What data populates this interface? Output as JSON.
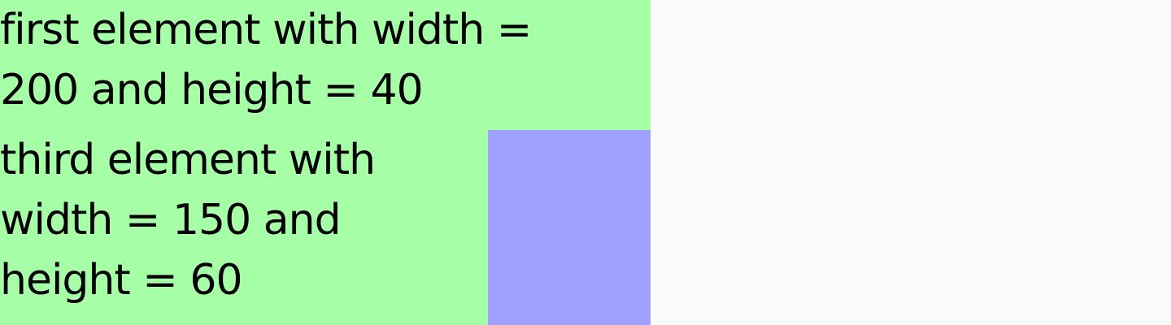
{
  "elements": {
    "first": {
      "line1": "first element with width =",
      "line2": "200 and height = 40"
    },
    "third": {
      "line1": "third element with",
      "line2": "width = 150 and",
      "line3": "height = 60"
    }
  },
  "colors": {
    "background": "#fafafa",
    "green": "#a6ffa6",
    "blue": "#a0a0ff",
    "text": "#000000"
  }
}
